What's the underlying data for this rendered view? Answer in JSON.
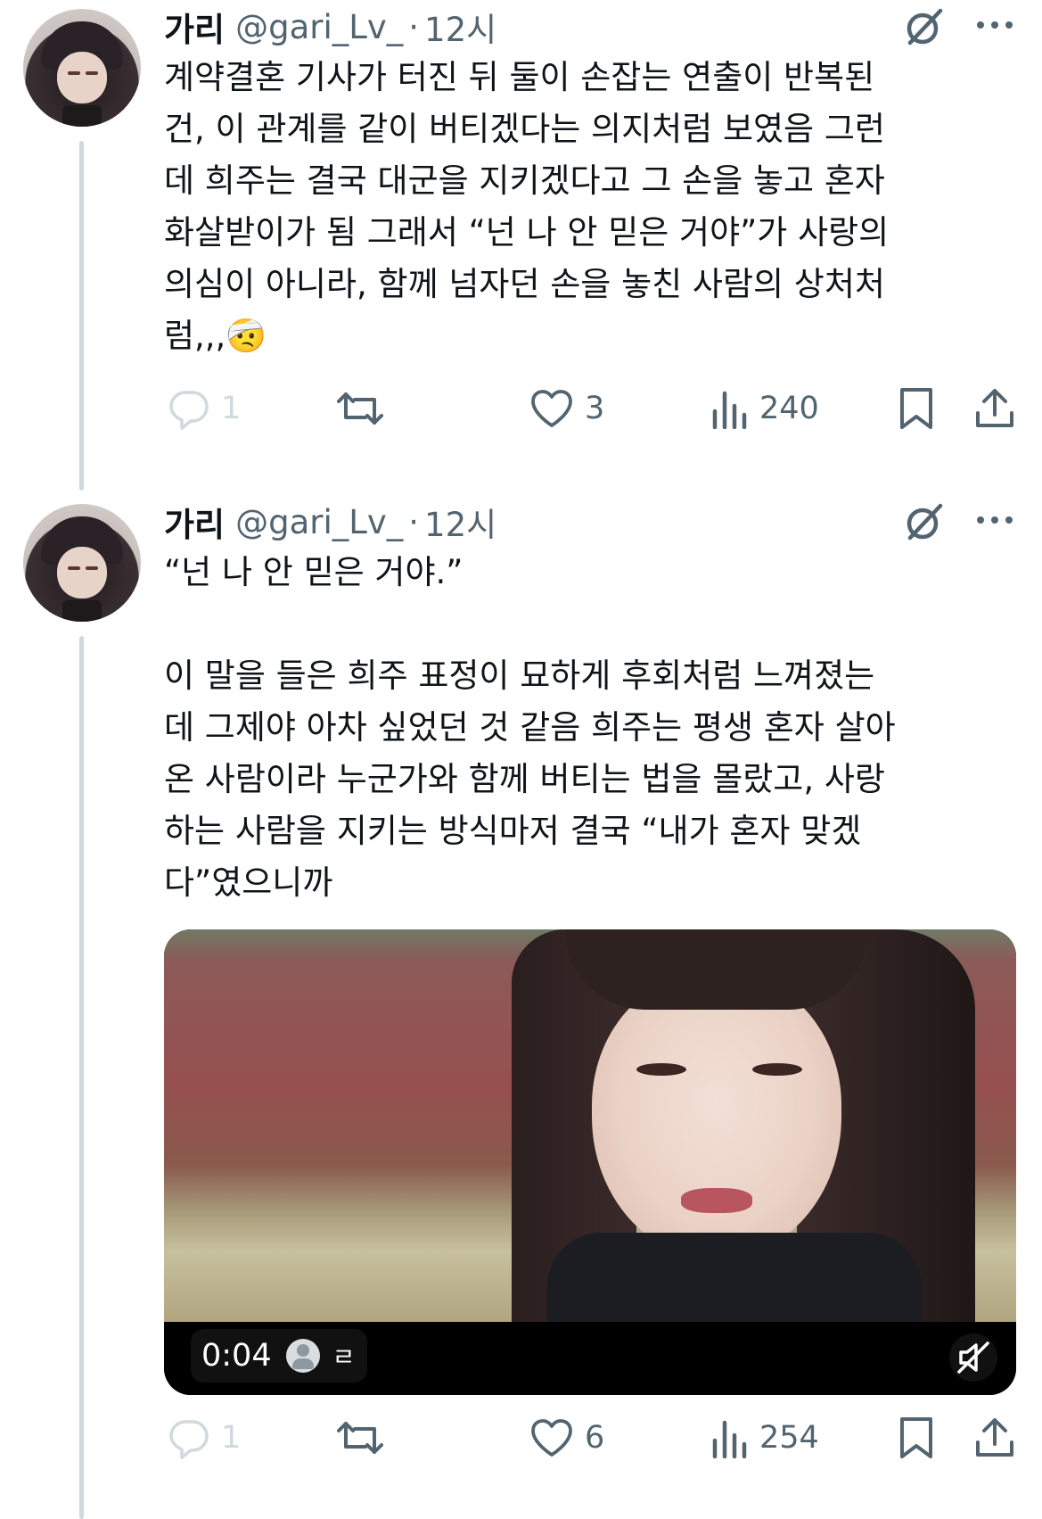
{
  "tweets": [
    {
      "author": {
        "name": "가리",
        "handle": "@gari_Lv_",
        "time": "12시"
      },
      "text": "계약결혼 기사가 터진 뒤 둘이 손잡는 연출이 반복된\n건, 이 관계를 같이 버티겠다는 의지처럼 보였음 그런\n데 희주는 결국 대군을 지키겠다고 그 손을 놓고 혼자\n화살받이가 됨 그래서 “넌 나 안 믿은 거야”가 사랑의\n의심이 아니라, 함께 넘자던 손을 놓친 사람의 상처처\n럼,,,🤕",
      "actions": {
        "reply": "1",
        "retweet": "",
        "like": "3",
        "views": "240"
      }
    },
    {
      "author": {
        "name": "가리",
        "handle": "@gari_Lv_",
        "time": "12시"
      },
      "text": "“넌 나 안 믿은 거야.”\n\n이 말을 들은 희주 표정이 묘하게 후회처럼 느껴졌는\n데 그제야 아차 싶었던 것 같음 희주는 평생 혼자 살아\n온 사람이라 누군가와 함께 버티는 법을 몰랐고, 사랑\n하는 사람을 지키는 방식마저 결국 “내가 혼자 맞겠\n다”였으니까",
      "video": {
        "duration": "0:04",
        "caption_label": "ㄹ"
      },
      "actions": {
        "reply": "1",
        "retweet": "",
        "like": "6",
        "views": "254"
      }
    }
  ],
  "icons": {
    "grok": "grok-icon",
    "more": "more-icon",
    "reply": "reply-icon",
    "retweet": "retweet-icon",
    "like": "like-icon",
    "views": "views-icon",
    "bookmark": "bookmark-icon",
    "share": "share-icon",
    "mute": "mute-icon"
  },
  "colors": {
    "text": "#0f1419",
    "secondary": "#536471",
    "thread_line": "#cfd9de",
    "faded": "#cfd9de"
  }
}
